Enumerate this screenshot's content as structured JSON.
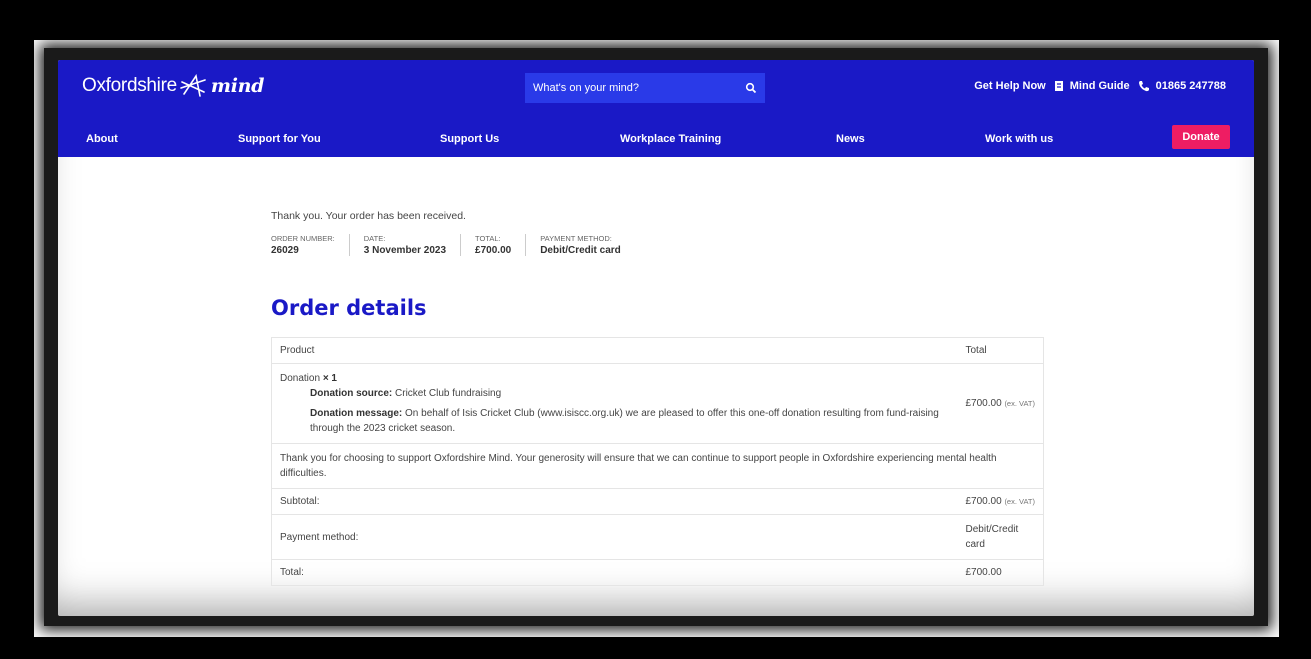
{
  "header": {
    "logo_text": "Oxfordshire",
    "logo_brand": "mind",
    "search_placeholder": "What's on your mind?",
    "get_help": "Get Help Now",
    "mind_guide": "Mind Guide",
    "phone": "01865 247788",
    "accent": "#1a19c6"
  },
  "nav": {
    "items": [
      "About",
      "Support for You",
      "Support Us",
      "Workplace Training",
      "News",
      "Work with us"
    ],
    "donate_label": "Donate",
    "donate_color": "#ee1d63"
  },
  "order": {
    "thanks": "Thank you. Your order has been received.",
    "overview": [
      {
        "label": "ORDER NUMBER:",
        "value": "26029"
      },
      {
        "label": "DATE:",
        "value": "3 November 2023"
      },
      {
        "label": "TOTAL:",
        "value": "£700.00"
      },
      {
        "label": "PAYMENT METHOD:",
        "value": "Debit/Credit card"
      }
    ],
    "details_title": "Order details",
    "table": {
      "header_product": "Product",
      "header_total": "Total",
      "product_name": "Donation",
      "product_qty": "× 1",
      "source_label": "Donation source:",
      "source_value": "Cricket Club fundraising",
      "message_label": "Donation message:",
      "message_value": "On behalf of Isis Cricket Club (www.isiscc.org.uk) we are pleased to offer this one-off donation resulting from fund-raising through the 2023 cricket season.",
      "line_total": "£700.00",
      "line_total_suffix": "(ex. VAT)",
      "note": "Thank you for choosing to support Oxfordshire Mind. Your generosity will ensure that we can continue to support people in Oxfordshire experiencing mental health difficulties.",
      "subtotal_label": "Subtotal:",
      "subtotal_value": "£700.00",
      "subtotal_suffix": "(ex. VAT)",
      "payment_label": "Payment method:",
      "payment_value": "Debit/Credit card",
      "total_label": "Total:",
      "total_value": "£700.00"
    }
  }
}
